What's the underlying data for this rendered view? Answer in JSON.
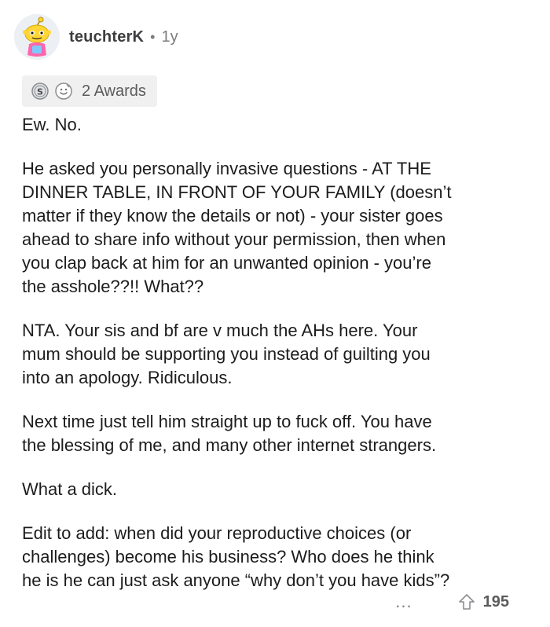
{
  "comment": {
    "author": "teuchterK",
    "separator": "•",
    "age": "1y",
    "awards_label": "2 Awards",
    "award_icons": [
      "silver-award-icon",
      "wholesome-award-icon"
    ],
    "avatar_icon": "snoo-avatar-icon",
    "paragraphs": [
      "Ew. No.",
      "He asked you personally invasive questions - AT THE\nDINNER TABLE, IN FRONT OF YOUR FAMILY (doesn’t\nmatter if they know the details or not) - your sister goes\nahead to share info without your permission, then when\nyou clap back at him for an unwanted opinion - you’re\nthe asshole??!! What??",
      "NTA. Your sis and bf are v much the AHs here. Your\nmum should be supporting you instead of guilting you\ninto an apology. Ridiculous.",
      "Next time just tell him straight up to fuck off. You have\nthe blessing of me, and many other internet strangers.",
      "What a dick.",
      "Edit to add: when did your reproductive choices (or\nchallenges) become his business? Who does he think\nhe is he can just ask anyone “why don’t you have kids”?"
    ],
    "more_label": "...",
    "upvote_icon": "upvote-arrow-icon",
    "score": "195"
  },
  "colors": {
    "text": "#1c1c1c",
    "muted": "#7c7c7c",
    "award_bg": "#f0f0f0",
    "avatar_yellow": "#ffd635",
    "avatar_bg": "#eceff3"
  }
}
